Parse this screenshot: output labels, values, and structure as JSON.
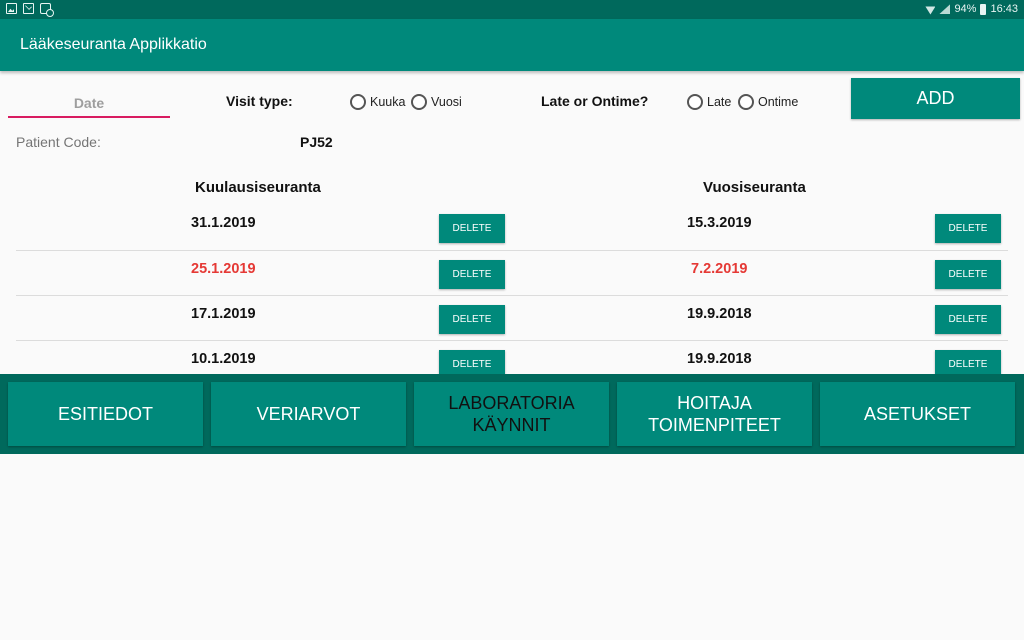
{
  "status_bar": {
    "icons_left": [
      "image-icon",
      "mail-icon",
      "gear-icon"
    ],
    "battery": "94%",
    "time": "16:43"
  },
  "app": {
    "title": "Lääkeseuranta Applikkatio"
  },
  "form": {
    "date_placeholder": "Date",
    "visit_type_label": "Visit type:",
    "visit_options": [
      "Kuuka",
      "Vuosi"
    ],
    "late_label": "Late or Ontime?",
    "late_options": [
      "Late",
      "Ontime"
    ],
    "add_label": "ADD"
  },
  "patient": {
    "label": "Patient Code:",
    "code": "PJ52"
  },
  "columns": {
    "left_title": "Kuulausiseuranta",
    "right_title": "Vuosiseuranta"
  },
  "delete_label": "DELETE",
  "rows": [
    {
      "left": "31.1.2019",
      "left_late": false,
      "right": "15.3.2019",
      "right_late": false
    },
    {
      "left": "25.1.2019",
      "left_late": true,
      "right": "7.2.2019",
      "right_late": true
    },
    {
      "left": "17.1.2019",
      "left_late": false,
      "right": "19.9.2018",
      "right_late": false
    },
    {
      "left": "10.1.2019",
      "left_late": false,
      "right": "19.9.2018",
      "right_late": false
    }
  ],
  "bottom_nav": [
    {
      "label": "ESITIEDOT",
      "active": false
    },
    {
      "label": "VERIARVOT",
      "active": false
    },
    {
      "label": "LABORATORIA\nKÄYNNIT",
      "active": true
    },
    {
      "label": "HOITAJA\nTOIMENPITEET",
      "active": false
    },
    {
      "label": "ASETUKSET",
      "active": false
    }
  ],
  "colors": {
    "primary": "#00897b",
    "primary_dark": "#00695c",
    "late": "#e53935",
    "accent": "#d81b60"
  }
}
